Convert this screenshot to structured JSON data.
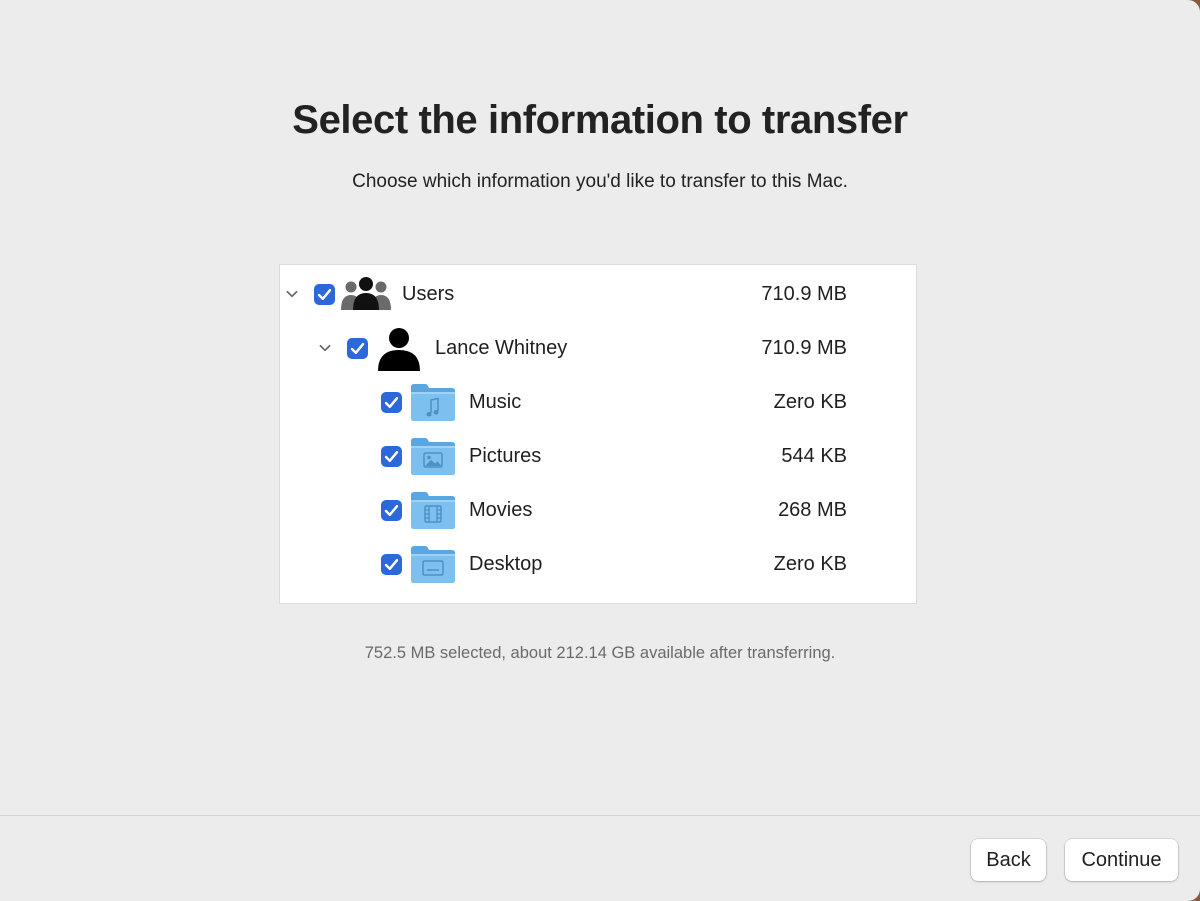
{
  "header": {
    "title": "Select the information to transfer",
    "subtitle": "Choose which information you'd like to transfer to this Mac."
  },
  "tree": {
    "users": {
      "label": "Users",
      "size": "710.9 MB",
      "checked": true,
      "expanded": true,
      "icon": "users-group-icon"
    },
    "account": {
      "label": "Lance Whitney",
      "size": "710.9 MB",
      "checked": true,
      "expanded": true,
      "icon": "person-icon"
    },
    "folders": [
      {
        "label": "Music",
        "size": "Zero KB",
        "checked": true,
        "icon": "music-folder-icon"
      },
      {
        "label": "Pictures",
        "size": "544 KB",
        "checked": true,
        "icon": "pictures-folder-icon"
      },
      {
        "label": "Movies",
        "size": "268 MB",
        "checked": true,
        "icon": "movies-folder-icon"
      },
      {
        "label": "Desktop",
        "size": "Zero KB",
        "checked": true,
        "icon": "desktop-folder-icon"
      }
    ]
  },
  "status": "752.5 MB selected, about 212.14 GB available after transferring.",
  "footer": {
    "back_label": "Back",
    "continue_label": "Continue"
  },
  "colors": {
    "accent": "#2c68d9",
    "background": "#ececec",
    "folder": "#6cb3e8"
  }
}
